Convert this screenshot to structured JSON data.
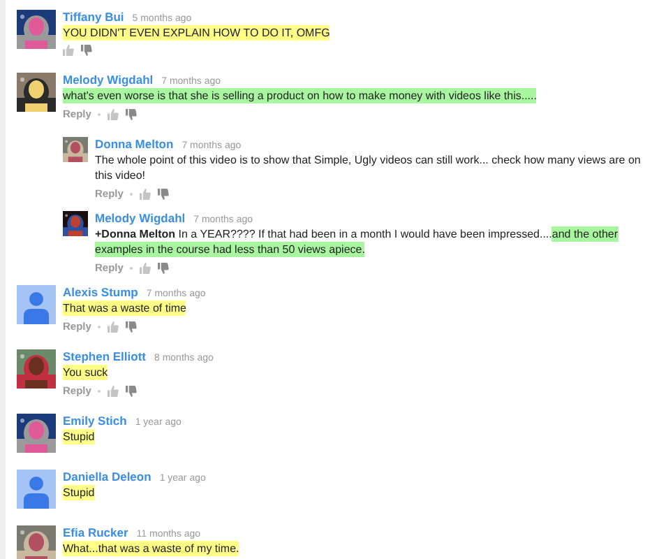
{
  "comments": [
    {
      "author": "Tiffany Bui",
      "time": "5 months ago",
      "avatar": {
        "kind": "picture"
      },
      "segments": [
        {
          "text": "YOU DIDN'T EVEN EXPLAIN HOW TO DO IT, OMFG",
          "color": "#ffff88"
        }
      ],
      "votes": true
    },
    {
      "author": "Melody Wigdahl",
      "time": "7 months ago",
      "avatar": {
        "kind": "picture"
      },
      "segments": [
        {
          "text": "what's even worse is that she is selling a product on how to make money with videos like this.....",
          "color": "#a8f7a0"
        }
      ],
      "reply": "Reply",
      "votes": true,
      "replies": [
        {
          "author": "Donna Melton",
          "time": "7 months ago",
          "avatar": {
            "kind": "picture"
          },
          "segments": [
            {
              "text": "The whole point of this video is to show that Simple, Ugly videos can still work... check how many views are on this video!"
            }
          ],
          "reply": "Reply",
          "votes": true
        },
        {
          "author": "Melody Wigdahl",
          "time": "7 months ago",
          "avatar": {
            "kind": "picture"
          },
          "segments": [
            {
              "text": "+Donna Melton",
              "bold": true
            },
            {
              "text": " In a YEAR???? If that had been in a month I would have been impressed...."
            },
            {
              "text": "and the other examples in the course had less than 50 views apiece.",
              "color": "#a8f7a0"
            }
          ],
          "reply": "Reply",
          "votes": true
        }
      ]
    },
    {
      "author": "Alexis Stump",
      "time": "7 months ago",
      "avatar": {
        "kind": "default"
      },
      "segments": [
        {
          "text": "That was a waste of time",
          "color": "#ffff88"
        }
      ],
      "reply": "Reply",
      "votes": true
    },
    {
      "author": "Stephen Elliott",
      "time": "8 months ago",
      "avatar": {
        "kind": "picture"
      },
      "segments": [
        {
          "text": "You suck",
          "color": "#ffff88"
        }
      ],
      "reply": "Reply",
      "votes": true
    },
    {
      "author": "Emily Stich",
      "time": "1 year ago",
      "avatar": {
        "kind": "picture"
      },
      "segments": [
        {
          "text": "Stupid",
          "color": "#ffff88"
        }
      ]
    },
    {
      "author": "Daniella Deleon",
      "time": "1 year ago",
      "avatar": {
        "kind": "default"
      },
      "segments": [
        {
          "text": "Stupid",
          "color": "#ffff88"
        }
      ]
    },
    {
      "author": "Efia Rucker",
      "time": "11 months ago",
      "avatar": {
        "kind": "picture"
      },
      "segments": [
        {
          "text": "What...that was a waste of my time.",
          "color": "#ffff88"
        }
      ]
    }
  ]
}
